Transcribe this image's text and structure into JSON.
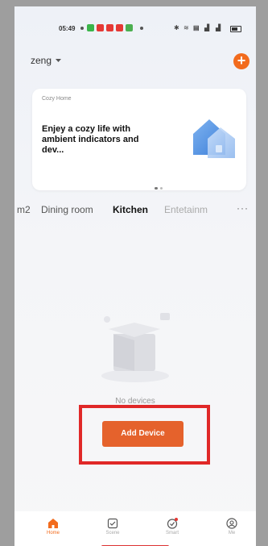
{
  "status_bar": {
    "time": "05:49",
    "icons": [
      "wifi-icon",
      "signal-icon",
      "signal-icon",
      "battery-icon"
    ]
  },
  "header": {
    "home_name": "zeng",
    "dropdown_icon": "caret-down-icon",
    "add_icon": "plus-icon",
    "add_symbol": "+"
  },
  "banner": {
    "tag": "Cozy Home",
    "text": "Enjey a cozy life with ambient indicators and dev...",
    "page_count": 2,
    "active_page": 0
  },
  "rooms": {
    "tabs": [
      {
        "label": "m2"
      },
      {
        "label": "Dining room"
      },
      {
        "label": "Kitchen"
      },
      {
        "label": "Entetainm"
      }
    ],
    "active_index": 2,
    "more_label": "···"
  },
  "empty_state": {
    "message": "No devices",
    "button_label": "Add Device"
  },
  "bottom_nav": {
    "items": [
      {
        "label": "Home",
        "icon": "home-icon"
      },
      {
        "label": "Scene",
        "icon": "scene-icon"
      },
      {
        "label": "Smart",
        "icon": "smart-icon"
      },
      {
        "label": "Me",
        "icon": "profile-icon"
      }
    ],
    "active_index": 0
  },
  "colors": {
    "accent": "#f26b1d",
    "button": "#e5622c",
    "highlight": "#e02828"
  }
}
